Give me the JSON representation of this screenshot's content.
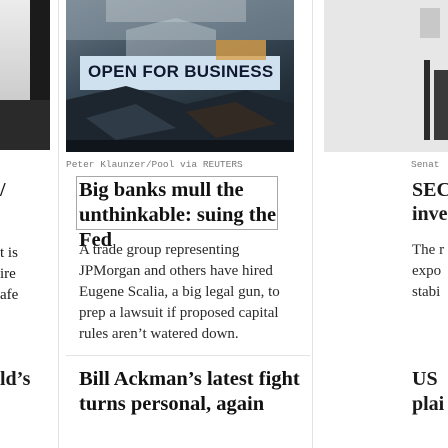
{
  "left_column": {
    "partial_title_1": "/",
    "partial_text_lines": [
      "t is",
      "ire",
      "afe"
    ],
    "partial_title_2": "ld’s"
  },
  "main": {
    "photo": {
      "sign_text": "OPEN FOR BUSINESS",
      "credit": "Peter Klaunzer/Pool via REUTERS"
    },
    "article_1": {
      "headline": "Big banks mull the unthinkable: suing the Fed",
      "dek": "A trade group representing JPMorgan and others have hired Eugene Scalia, a big legal gun, to prep a lawsuit if proposed capital rules aren’t watered down."
    },
    "article_2": {
      "headline": "Bill Ackman’s latest fight turns personal, again"
    }
  },
  "right_column": {
    "partial_credit": "Senat",
    "partial_title_lines": [
      "SEC",
      "inve"
    ],
    "partial_text_lines": [
      "The r",
      "expo",
      "stabi"
    ],
    "partial_title_2_lines": [
      "US ",
      "plai"
    ]
  },
  "colors": {
    "separator": "#e3e3e3",
    "headline_border": "#a7a7a7",
    "credit_text": "#7a7a7a"
  }
}
